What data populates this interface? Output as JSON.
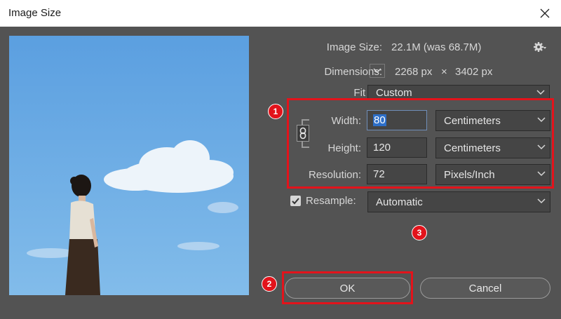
{
  "window": {
    "title": "Image Size"
  },
  "image_size": {
    "label": "Image Size:",
    "value": "22.1M (was 68.7M)"
  },
  "dimensions": {
    "label": "Dimensions:",
    "width": "2268 px",
    "times": "×",
    "height": "3402 px"
  },
  "fit_to": {
    "label": "Fit To:",
    "value": "Custom"
  },
  "width": {
    "label": "Width:",
    "value": "80",
    "unit": "Centimeters"
  },
  "height": {
    "label": "Height:",
    "value": "120",
    "unit": "Centimeters"
  },
  "resolution": {
    "label": "Resolution:",
    "value": "72",
    "unit": "Pixels/Inch"
  },
  "resample": {
    "label": "Resample:",
    "value": "Automatic",
    "checked": true
  },
  "buttons": {
    "ok": "OK",
    "cancel": "Cancel"
  },
  "annotations": {
    "badge1": "1",
    "badge2": "2",
    "badge3": "3"
  },
  "colors": {
    "dialog_bg": "#535353",
    "field_bg": "#454545",
    "accent_red": "#e3131b",
    "selection": "#2d6fc9",
    "sky": "#6aaae3"
  }
}
